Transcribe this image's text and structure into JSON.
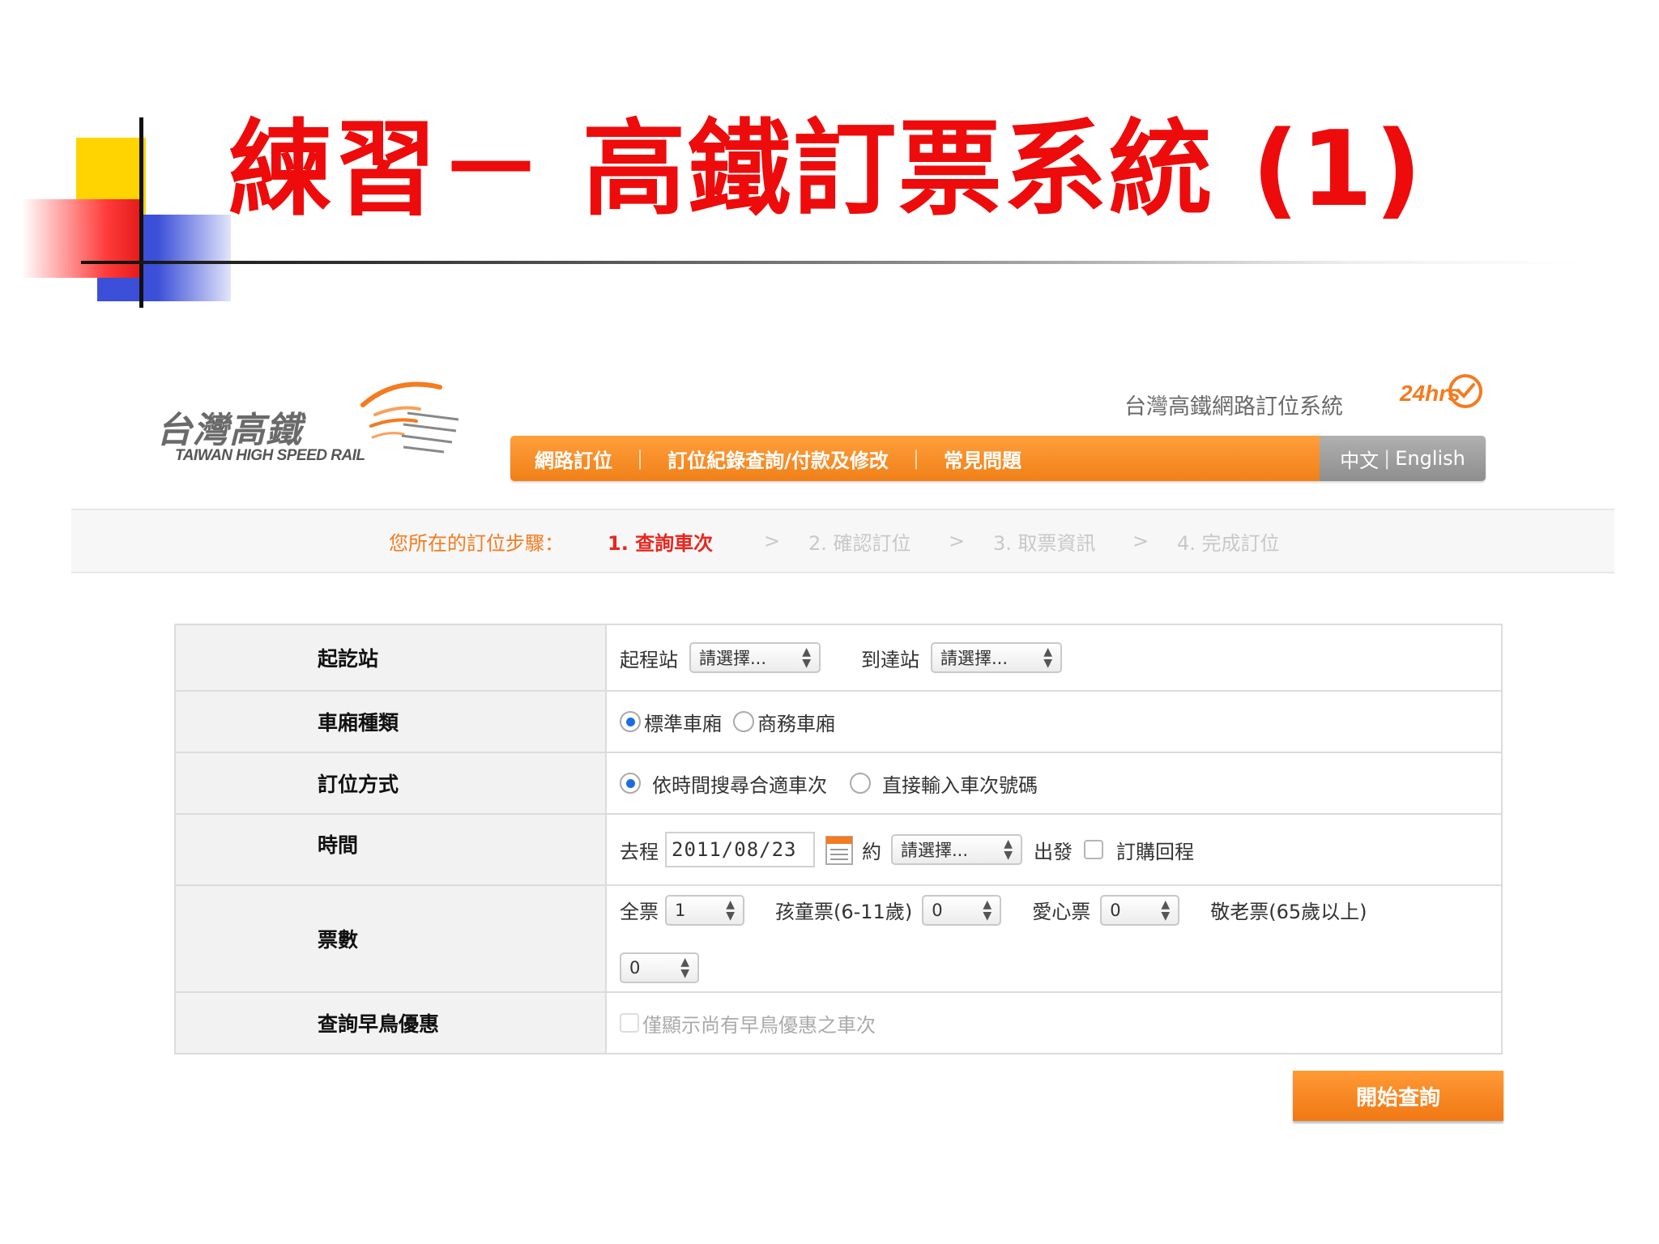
{
  "slide": {
    "title": "練習－ 高鐵訂票系統 (1)"
  },
  "header": {
    "logo_zh": "台灣高鐵",
    "logo_en": "TAIWAN HIGH SPEED RAIL",
    "system_title": "台灣高鐵網路訂位系統",
    "badge": "24hrs"
  },
  "nav": {
    "items": [
      {
        "label": "網路訂位"
      },
      {
        "label": "訂位紀錄查詢/付款及修改"
      },
      {
        "label": "常見問題"
      }
    ],
    "lang_zh": "中文",
    "lang_en": "English"
  },
  "steps": {
    "label": "您所在的訂位步驟：",
    "items": [
      {
        "label": "1. 查詢車次"
      },
      {
        "label": "2. 確認訂位"
      },
      {
        "label": "3. 取票資訊"
      },
      {
        "label": "4. 完成訂位"
      }
    ],
    "arrow": ">"
  },
  "form": {
    "stations": {
      "label": "起訖站",
      "origin_label": "起程站",
      "origin_value": "請選擇...",
      "dest_label": "到達站",
      "dest_value": "請選擇..."
    },
    "car_type": {
      "label": "車廂種類",
      "options": [
        "標準車廂",
        "商務車廂"
      ],
      "selected": "標準車廂"
    },
    "booking_method": {
      "label": "訂位方式",
      "options": [
        "依時間搜尋合適車次",
        "直接輸入車次號碼"
      ],
      "selected": "依時間搜尋合適車次"
    },
    "time": {
      "label": "時間",
      "outbound_label": "去程",
      "date": "2011/08/23",
      "approx_label": "約",
      "time_value": "請選擇...",
      "depart_label": "出發",
      "return_label": "訂購回程"
    },
    "tickets": {
      "label": "票數",
      "adult_label": "全票",
      "adult_value": "1",
      "child_label": "孩童票(6-11歲)",
      "child_value": "0",
      "disabled_label": "愛心票",
      "disabled_value": "0",
      "senior_label": "敬老票(65歲以上)",
      "senior_value": "0"
    },
    "early_bird": {
      "label": "查詢早鳥優惠",
      "checkbox_label": "僅顯示尚有早鳥優惠之車次"
    }
  },
  "search_button": "開始查詢",
  "colors": {
    "title_red": "#ee0b0b",
    "brand_orange": "#f47b20",
    "active_step_red": "#e8261e"
  }
}
